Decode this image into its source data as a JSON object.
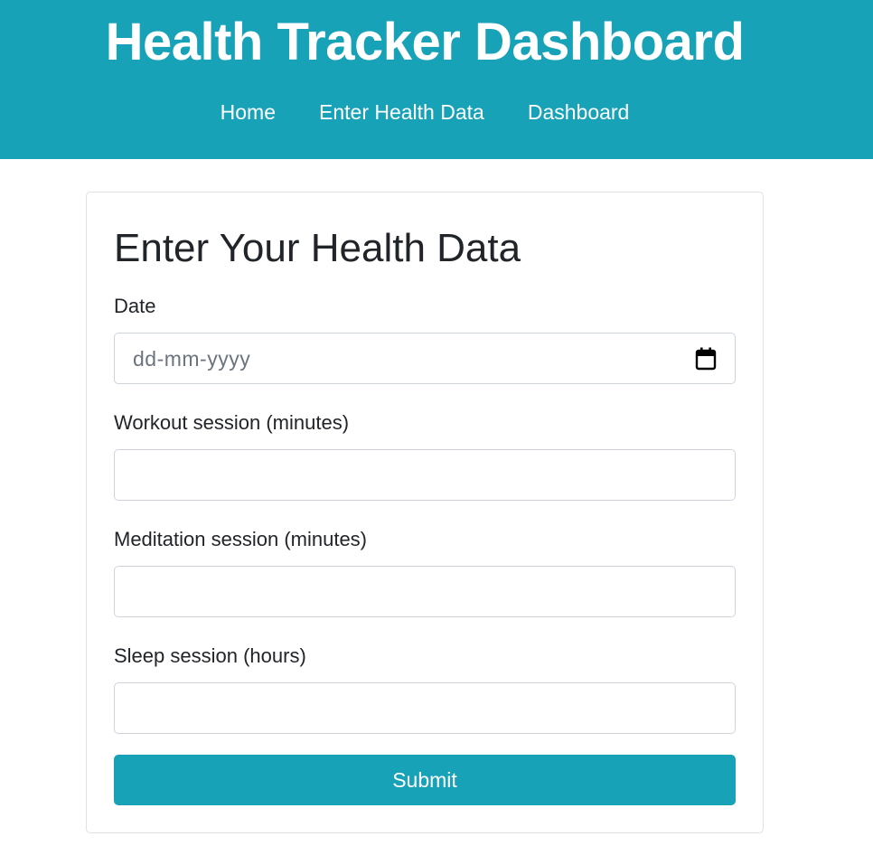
{
  "header": {
    "title": "Health Tracker Dashboard",
    "nav": [
      "Home",
      "Enter Health Data",
      "Dashboard"
    ]
  },
  "form": {
    "title": "Enter Your Health Data",
    "date": {
      "label": "Date",
      "placeholder": "dd-mm-yyyy",
      "icon": "calendar-icon"
    },
    "workout": {
      "label": "Workout session (minutes)",
      "value": ""
    },
    "meditation": {
      "label": "Meditation session (minutes)",
      "value": ""
    },
    "sleep": {
      "label": "Sleep session (hours)",
      "value": ""
    },
    "submit_label": "Submit"
  },
  "colors": {
    "brand": "#17a2b8",
    "text": "#212529",
    "border": "#ced4da",
    "placeholder": "#6c757d"
  }
}
